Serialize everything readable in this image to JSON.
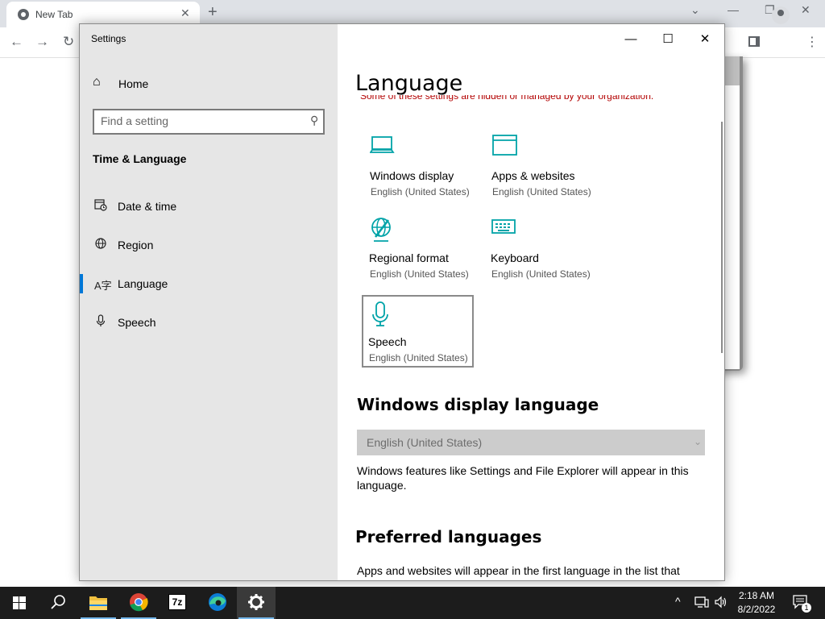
{
  "browser": {
    "tab_title": "New Tab",
    "tab_close": "✕",
    "new_tab": "+",
    "minimize": "—",
    "restore": "❐",
    "close": "✕",
    "tab_list": "⌄"
  },
  "settings": {
    "window_title": "Settings",
    "controls": {
      "minimize": "—",
      "maximize": "☐",
      "close": "✕"
    },
    "home_label": "Home",
    "search_placeholder": "Find a setting",
    "section_title": "Time & Language",
    "nav": [
      {
        "label": "Date & time",
        "icon": "calendar-clock-icon"
      },
      {
        "label": "Region",
        "icon": "globe-icon"
      },
      {
        "label": "Language",
        "icon": "language-icon",
        "selected": true
      },
      {
        "label": "Speech",
        "icon": "microphone-icon"
      }
    ],
    "page_title": "Language",
    "policy_note": "Some of these settings are hidden or managed by your organization.",
    "tiles": [
      {
        "name": "Windows display",
        "value": "English (United States)",
        "icon": "monitor-icon"
      },
      {
        "name": "Apps & websites",
        "value": "English (United States)",
        "icon": "window-icon"
      },
      {
        "name": "Regional format",
        "value": "English (United States)",
        "icon": "globe-edit-icon"
      },
      {
        "name": "Keyboard",
        "value": "English (United States)",
        "icon": "keyboard-icon"
      },
      {
        "name": "Speech",
        "value": "English (United States)",
        "icon": "microphone-icon",
        "focused": true
      }
    ],
    "display_language_heading": "Windows display language",
    "display_language_value": "English (United States)",
    "display_language_desc": "Windows features like Settings and File Explorer will appear in this language.",
    "preferred_heading": "Preferred languages",
    "preferred_desc": "Apps and websites will appear in the first language in the list that"
  },
  "taskbar": {
    "apps": [
      "start-icon",
      "search-icon",
      "file-explorer-icon",
      "chrome-icon",
      "7zip-icon",
      "edge-icon",
      "settings-icon"
    ],
    "time": "2:18 AM",
    "date": "8/2/2022",
    "notification_count": "1",
    "seven_zip_label": "7z"
  },
  "colors": {
    "accent": "#0078d7",
    "icon_teal": "#00a3a8",
    "policy_red": "#b30000",
    "sidebar_bg": "#e6e6e6"
  }
}
